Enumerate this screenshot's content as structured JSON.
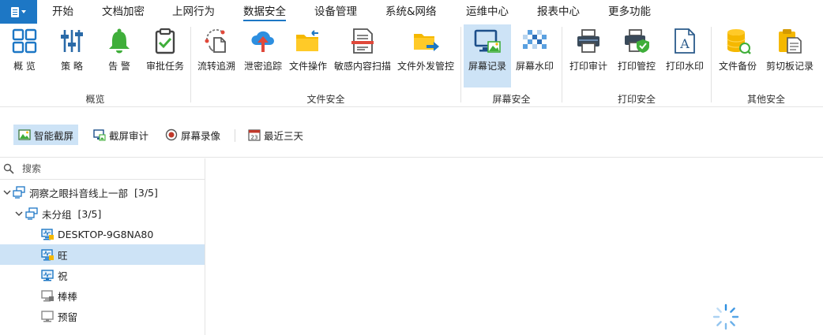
{
  "menubar": {
    "app_menu_icon": "document-menu-icon",
    "tabs": [
      {
        "label": "开始"
      },
      {
        "label": "文档加密"
      },
      {
        "label": "上网行为"
      },
      {
        "label": "数据安全",
        "active": true
      },
      {
        "label": "设备管理"
      },
      {
        "label": "系统&网络"
      },
      {
        "label": "运维中心"
      },
      {
        "label": "报表中心"
      },
      {
        "label": "更多功能"
      }
    ]
  },
  "ribbon": {
    "buttons": [
      {
        "label": "概 览",
        "icon": "grid-overview-icon"
      },
      {
        "label": "策 略",
        "icon": "sliders-policy-icon"
      },
      {
        "label": "告 警",
        "icon": "bell-alert-icon"
      },
      {
        "label": "审批任务",
        "icon": "clipboard-check-icon"
      },
      {
        "label": "流转追溯",
        "icon": "document-flow-icon"
      },
      {
        "label": "泄密追踪",
        "icon": "cloud-upload-icon"
      },
      {
        "label": "文件操作",
        "icon": "folder-arrow-icon"
      },
      {
        "label": "敏感内容扫描",
        "icon": "document-scan-icon"
      },
      {
        "label": "文件外发管控",
        "icon": "folder-send-icon"
      },
      {
        "label": "屏幕记录",
        "icon": "monitor-image-icon",
        "selected": true
      },
      {
        "label": "屏幕水印",
        "icon": "mosaic-watermark-icon"
      },
      {
        "label": "打印审计",
        "icon": "printer-icon"
      },
      {
        "label": "打印管控",
        "icon": "printer-shield-icon"
      },
      {
        "label": "打印水印",
        "icon": "letter-a-document-icon"
      },
      {
        "label": "文件备份",
        "icon": "database-backup-icon"
      },
      {
        "label": "剪切板记录",
        "icon": "clipboard-record-icon"
      }
    ],
    "groups": [
      {
        "label": "概览"
      },
      {
        "label": "文件安全"
      },
      {
        "label": "屏幕安全"
      },
      {
        "label": "打印安全"
      },
      {
        "label": "其他安全"
      }
    ]
  },
  "toolbar": {
    "smart_capture": "智能截屏",
    "capture_audit": "截屏审计",
    "screen_record": "屏幕录像",
    "time_range": "最近三天"
  },
  "search": {
    "placeholder": "搜索"
  },
  "tree": [
    {
      "label": "洞察之眼抖音线上一部",
      "count": "[3/5]",
      "level": 0,
      "icon": "network-computers-icon"
    },
    {
      "label": "未分组",
      "count": "[3/5]",
      "level": 1,
      "icon": "network-computers-icon"
    },
    {
      "label": "DESKTOP-9G8NA80",
      "level": 2,
      "icon": "monitor-online-locked-icon"
    },
    {
      "label": "旺",
      "level": 2,
      "icon": "monitor-online-locked-icon",
      "selected": true
    },
    {
      "label": "祝",
      "level": 2,
      "icon": "monitor-online-icon"
    },
    {
      "label": "棒棒",
      "level": 2,
      "icon": "monitor-offline-locked-icon"
    },
    {
      "label": "预留",
      "level": 2,
      "icon": "monitor-offline-icon"
    }
  ],
  "colors": {
    "accent": "#1d77c5",
    "selected_bg": "#cde3f6",
    "alert_green": "#3fae3a",
    "folder_yellow": "#f5b800",
    "cloud_blue": "#2d8fe0",
    "upload_red": "#e0483a"
  }
}
